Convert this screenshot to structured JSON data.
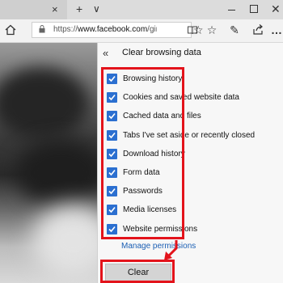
{
  "browser": {
    "new_tab_symbol": "+",
    "tab_list_symbol": "∨",
    "tab_close_symbol": "×",
    "window_close_symbol": "✕",
    "address": {
      "prefix": "https://",
      "domain": "www.facebook.com",
      "path": "/ginc"
    }
  },
  "panel": {
    "back_symbol": "«",
    "title": "Clear browsing data",
    "options": [
      {
        "label": "Browsing history",
        "checked": true
      },
      {
        "label": "Cookies and saved website data",
        "checked": true
      },
      {
        "label": "Cached data and files",
        "checked": true
      },
      {
        "label": "Tabs I've set aside or recently closed",
        "checked": true
      },
      {
        "label": "Download history",
        "checked": true
      },
      {
        "label": "Form data",
        "checked": true
      },
      {
        "label": "Passwords",
        "checked": true
      },
      {
        "label": "Media licenses",
        "checked": true
      },
      {
        "label": "Website permissions",
        "checked": true
      }
    ],
    "manage_link": "Manage permissions",
    "clear_button": "Clear"
  },
  "colors": {
    "checkbox": "#2b6fd0",
    "annotation": "#e3131b",
    "link": "#1a5fb4"
  }
}
